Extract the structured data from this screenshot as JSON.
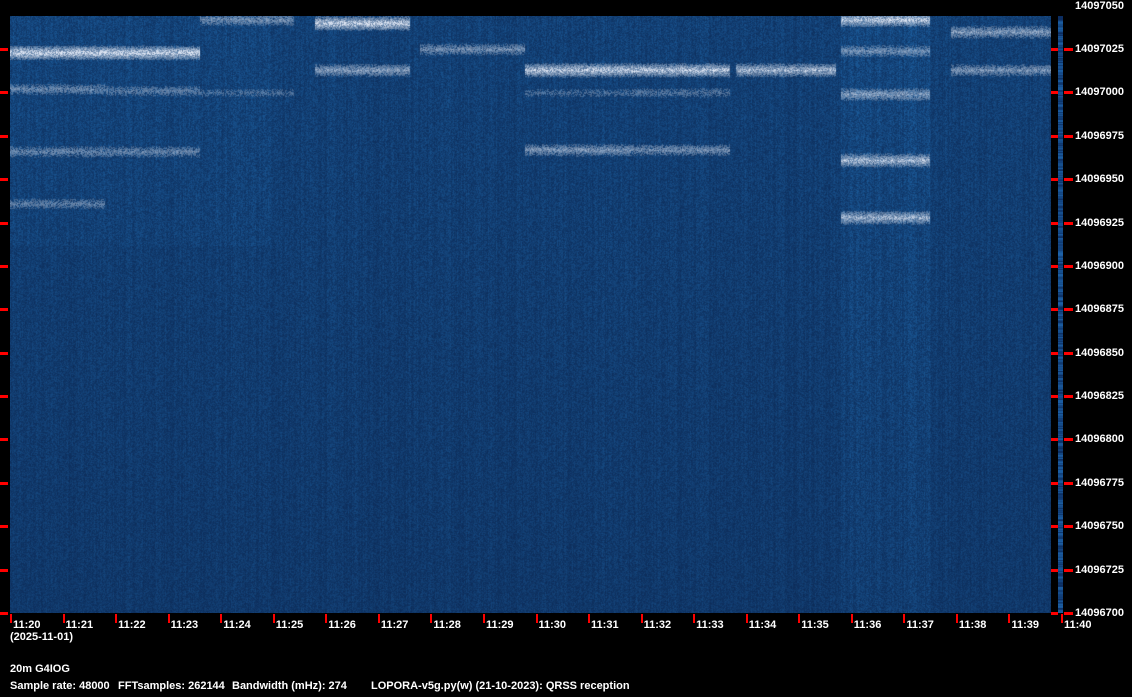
{
  "chart_data": {
    "type": "heatmap",
    "title": "20m G4IOG",
    "date": "(2025-11-01)",
    "x_ticks": [
      "11:20",
      "11:21",
      "11:22",
      "11:23",
      "11:24",
      "11:25",
      "11:26",
      "11:27",
      "11:28",
      "11:29",
      "11:30",
      "11:31",
      "11:32",
      "11:33",
      "11:34",
      "11:35",
      "11:36",
      "11:37",
      "11:38",
      "11:39",
      "11:40"
    ],
    "xlim_minutes": [
      0,
      20
    ],
    "y_ticks": [
      "14097050",
      "14097025",
      "14097000",
      "14096975",
      "14096950",
      "14096925",
      "14096900",
      "14096875",
      "14096850",
      "14096825",
      "14096800",
      "14096775",
      "14096750",
      "14096725",
      "14096700"
    ],
    "ylim_hz": [
      14096700,
      14097044
    ],
    "colormap": [
      "#061a45",
      "#0d3a80",
      "#e8eef8"
    ],
    "signals": [
      {
        "t": [
          0.0,
          1.8
        ],
        "f": 14097023,
        "level": 1.0
      },
      {
        "t": [
          0.0,
          1.8
        ],
        "f": 14097002,
        "level": 0.45
      },
      {
        "t": [
          0.0,
          1.8
        ],
        "f": 14096966,
        "level": 0.45
      },
      {
        "t": [
          0.0,
          1.8
        ],
        "f": 14096936,
        "level": 0.4
      },
      {
        "t": [
          1.8,
          3.6
        ],
        "f": 14097023,
        "level": 1.0
      },
      {
        "t": [
          1.8,
          3.6
        ],
        "f": 14097001,
        "level": 0.4
      },
      {
        "t": [
          1.8,
          3.6
        ],
        "f": 14096966,
        "level": 0.45
      },
      {
        "t": [
          3.6,
          5.4
        ],
        "f": 14097042,
        "level": 0.5
      },
      {
        "t": [
          3.6,
          5.4
        ],
        "f": 14097000,
        "level": 0.3
      },
      {
        "t": [
          5.8,
          7.6
        ],
        "f": 14097040,
        "level": 1.0
      },
      {
        "t": [
          5.8,
          7.6
        ],
        "f": 14097013,
        "level": 0.6
      },
      {
        "t": [
          7.8,
          9.8
        ],
        "f": 14097025,
        "level": 0.5
      },
      {
        "t": [
          9.8,
          11.8
        ],
        "f": 14097013,
        "level": 0.9
      },
      {
        "t": [
          9.8,
          11.8
        ],
        "f": 14097000,
        "level": 0.3
      },
      {
        "t": [
          9.8,
          11.8
        ],
        "f": 14096967,
        "level": 0.55
      },
      {
        "t": [
          11.8,
          13.7
        ],
        "f": 14097013,
        "level": 0.9
      },
      {
        "t": [
          11.8,
          13.7
        ],
        "f": 14097000,
        "level": 0.35
      },
      {
        "t": [
          11.8,
          13.7
        ],
        "f": 14096967,
        "level": 0.5
      },
      {
        "t": [
          13.8,
          15.7
        ],
        "f": 14097013,
        "level": 0.8
      },
      {
        "t": [
          15.8,
          17.5
        ],
        "f": 14097042,
        "level": 0.9
      },
      {
        "t": [
          15.8,
          17.5
        ],
        "f": 14097024,
        "level": 0.5
      },
      {
        "t": [
          15.8,
          17.5
        ],
        "f": 14096999,
        "level": 0.6
      },
      {
        "t": [
          15.8,
          17.5
        ],
        "f": 14096961,
        "level": 0.8
      },
      {
        "t": [
          15.8,
          17.5
        ],
        "f": 14096928,
        "level": 0.75
      },
      {
        "t": [
          17.9,
          19.8
        ],
        "f": 14097035,
        "level": 0.6
      },
      {
        "t": [
          17.9,
          19.8
        ],
        "f": 14097013,
        "level": 0.55
      }
    ]
  },
  "footer": {
    "station": "20m G4IOG",
    "sample_rate": "Sample rate: 48000",
    "fft_samples": "FFTsamples: 262144",
    "bandwidth": "Bandwidth (mHz): 274",
    "software": "LOPORA-v5g.py(w) (21-10-2023): QRSS reception"
  }
}
